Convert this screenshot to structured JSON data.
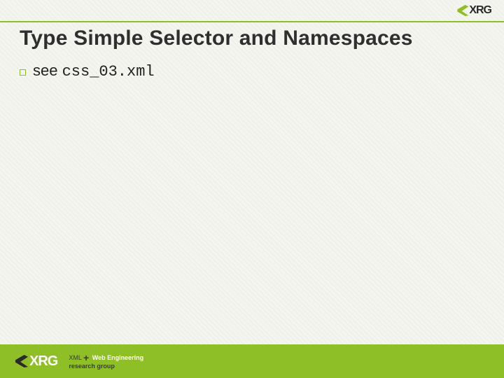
{
  "brand": {
    "name": "XRG",
    "tagline_xml": "XML",
    "tagline_web": "Web Engineering",
    "tagline_group": "research group"
  },
  "slide": {
    "title": "Type Simple Selector and Namespaces",
    "bullets": [
      {
        "prefix": "see ",
        "code": "css_03.xml"
      }
    ]
  },
  "colors": {
    "accent": "#8fbf26"
  }
}
